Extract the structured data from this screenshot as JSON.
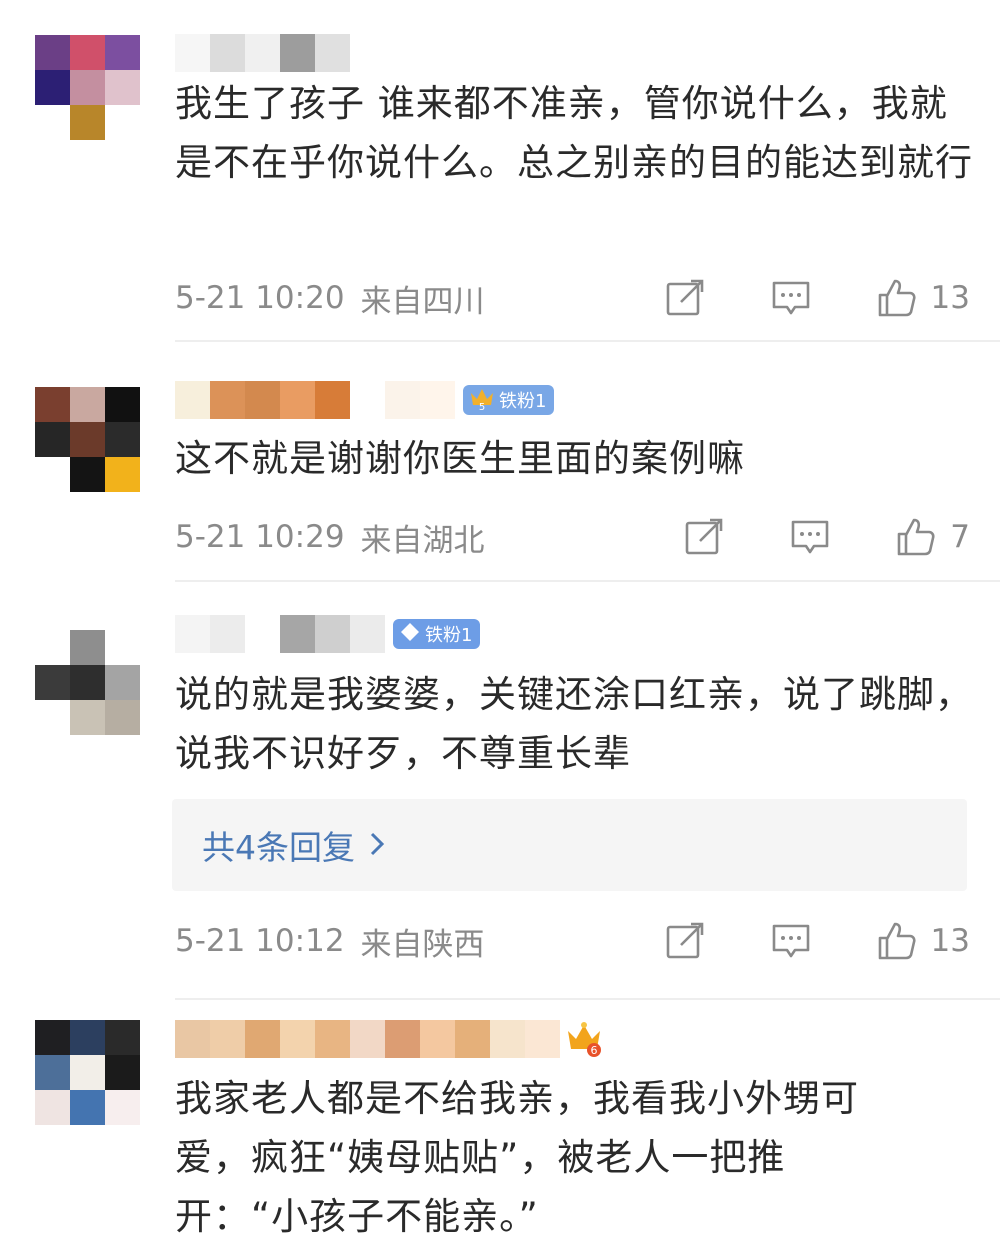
{
  "comments": [
    {
      "text": "我生了孩子 谁来都不准亲，管你说什么，我就是不在乎你说什么。总之别亲的目的能达到就行",
      "time": "5-21 10:20",
      "location": "来自四川",
      "likes": "13",
      "avatar_colors": [
        "#6b3f86",
        "#d0506a",
        "#7c4fa0",
        "#2c1f74",
        "#c48fa0",
        "#e0c2cc",
        "#ffffff",
        "#b8862a",
        "#ffffff"
      ],
      "name_colors": [
        "#f6f6f6",
        "#dcdcdc",
        "#f0f0f0",
        "#9d9d9d",
        "#e0e0e0"
      ]
    },
    {
      "text": "这不就是谢谢你医生里面的案例嘛",
      "time": "5-21 10:29",
      "location": "来自湖北",
      "likes": "7",
      "badge": "铁粉1",
      "avatar_colors": [
        "#7a3f2f",
        "#c9a8a0",
        "#111111",
        "#262626",
        "#6b3a2a",
        "#2b2b2b",
        "#ffffff",
        "#141414",
        "#f2b21b"
      ],
      "name_colors": [
        "#f7efdc",
        "#dc9258",
        "#d3894e",
        "#e99c62",
        "#d77c38",
        "#ffffff",
        "#fbf3ea",
        "#fff5eb",
        "#ffe7d8"
      ]
    },
    {
      "text": "说的就是我婆婆，关键还涂口红亲，说了跳脚，说我不识好歹，不尊重长辈",
      "time": "5-21 10:12",
      "location": "来自陕西",
      "likes": "13",
      "badge": "铁粉1",
      "replies_label": "共4条回复",
      "avatar_colors": [
        "#ffffff",
        "#8e8e8e",
        "#ffffff",
        "#3b3b3b",
        "#2e2e2e",
        "#a4a4a4",
        "#ffffff",
        "#c9c2b5",
        "#b6aea2"
      ],
      "name_colors": [
        "#f4f4f4",
        "#ececec",
        "#ffffff",
        "#a6a6a6",
        "#cfcfcf",
        "#ebebeb"
      ]
    },
    {
      "text": "我家老人都是不给我亲，我看我小外甥可爱，疯狂“姨母贴贴”，被老人一把推开：“小孩子不能亲。”",
      "avatar_colors": [
        "#1f1f22",
        "#2c3f5f",
        "#2a2a2a",
        "#4d6f99",
        "#f2eee8",
        "#1b1b1b",
        "#efe4e2",
        "#4474b0",
        "#f7eeee"
      ],
      "name_colors": [
        "#e9c7a4",
        "#efcda8",
        "#e0a872",
        "#f3d3ad",
        "#e8b583",
        "#f2d8c6",
        "#dc9d73",
        "#f4c8a0",
        "#e5b07a",
        "#f6e4cc",
        "#fbe7d4",
        "#ffe8d6"
      ]
    }
  ],
  "icons": [
    "share-icon",
    "comment-icon",
    "like-icon",
    "chevron-right-icon",
    "crown-badge-icon",
    "diamond-icon"
  ]
}
